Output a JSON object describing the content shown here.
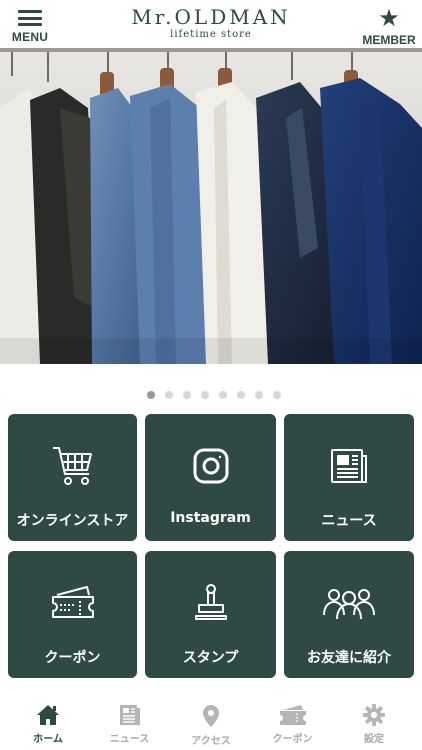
{
  "header": {
    "menu_label": "MENU",
    "brand_name": "Mr.OLDMAN",
    "brand_sub": "lifetime store",
    "member_label": "MEMBER",
    "member_icon": "star-icon"
  },
  "carousel": {
    "slide_count": 8,
    "active_index": 0
  },
  "tiles": [
    {
      "label": "オンラインストア",
      "icon": "cart-icon"
    },
    {
      "label": "Instagram",
      "icon": "instagram-icon"
    },
    {
      "label": "ニュース",
      "icon": "newspaper-icon"
    },
    {
      "label": "クーポン",
      "icon": "ticket-icon"
    },
    {
      "label": "スタンプ",
      "icon": "stamp-icon"
    },
    {
      "label": "お友達に紹介",
      "icon": "friends-icon"
    }
  ],
  "tabbar": [
    {
      "label": "ホーム",
      "icon": "home-icon",
      "active": true
    },
    {
      "label": "ニュース",
      "icon": "news-icon",
      "active": false
    },
    {
      "label": "アクセス",
      "icon": "location-icon",
      "active": false
    },
    {
      "label": "クーポン",
      "icon": "coupon-icon",
      "active": false
    },
    {
      "label": "設定",
      "icon": "gear-icon",
      "active": false
    }
  ],
  "colors": {
    "primary": "#2f4a45",
    "tab_inactive": "#a9a9a9",
    "dot_active": "#9a9a9a",
    "dot_inactive": "#d6d6d6"
  }
}
